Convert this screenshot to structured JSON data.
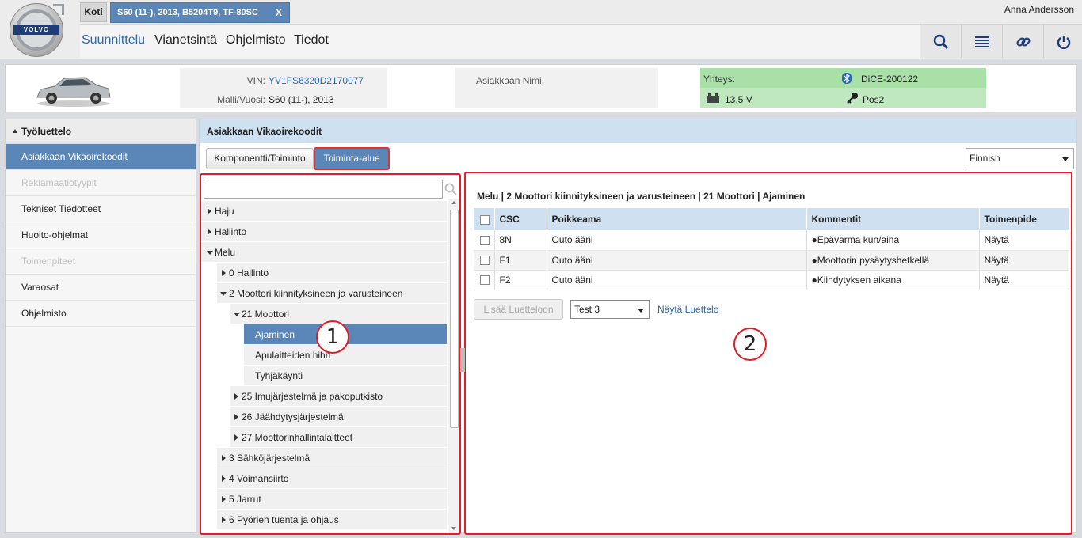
{
  "header": {
    "logo_text": "VOLVO",
    "tab_home": "Koti",
    "tab_vehicle": "S60 (11-), 2013, B5204T9, TF-80SC",
    "tab_close": "X",
    "user": "Anna Andersson",
    "nav": [
      "Suunnittelu",
      "Vianetsintä",
      "Ohjelmisto",
      "Tiedot"
    ],
    "tools": [
      "search-icon",
      "list-icon",
      "link-icon",
      "power-icon"
    ]
  },
  "vehicle": {
    "vin_label": "VIN:",
    "vin": "YV1FS6320D2170077",
    "model_label": "Malli/Vuosi:",
    "model": "S60 (11-), 2013",
    "customer_label": "Asiakkaan Nimi:",
    "conn_label": "Yhteys:",
    "device": "DiCE-200122",
    "voltage": "13,5 V",
    "key_pos": "Pos2"
  },
  "sidebar": {
    "title": "Työluettelo",
    "items": [
      {
        "label": "Asiakkaan Vikaoirekoodit",
        "state": "active"
      },
      {
        "label": "Reklamaatiotyypit",
        "state": "disabled"
      },
      {
        "label": "Tekniset Tiedotteet",
        "state": "normal"
      },
      {
        "label": "Huolto-ohjelmat",
        "state": "normal"
      },
      {
        "label": "Toimenpiteet",
        "state": "disabled"
      },
      {
        "label": "Varaosat",
        "state": "normal"
      },
      {
        "label": "Ohjelmisto",
        "state": "normal"
      }
    ]
  },
  "content": {
    "title": "Asiakkaan Vikaoirekoodit",
    "btn_component": "Komponentti/Toiminto",
    "btn_area": "Toiminta-alue",
    "language": "Finnish"
  },
  "tree": [
    "Haju",
    "Hallinto",
    "Melu",
    "0 Hallinto",
    "2 Moottori kiinnityksineen ja varusteineen",
    "21 Moottori",
    "Ajaminen",
    "Apulaitteiden hihn",
    "Tyhjäkäynti",
    "25 Imujärjestelmä ja pakoputkisto",
    "26 Jäähdytysjärjestelmä",
    "27 Moottorinhallintalaitteet",
    "3 Sähköjärjestelmä",
    "4 Voimansiirto",
    "5 Jarrut",
    "6 Pyörien tuenta ja ohjaus"
  ],
  "detail": {
    "breadcrumb": "Melu | 2 Moottori kiinnityksineen ja varusteineen | 21 Moottori | Ajaminen",
    "columns": [
      "CSC",
      "Poikkeama",
      "Kommentit",
      "Toimenpide"
    ],
    "rows": [
      {
        "csc": "8N",
        "dev": "Outo ääni",
        "comment": "Epävarma kun/aina",
        "action": "Näytä"
      },
      {
        "csc": "F1",
        "dev": "Outo ääni",
        "comment": "Moottorin pysäytyshetkellä",
        "action": "Näytä"
      },
      {
        "csc": "F2",
        "dev": "Outo ääni",
        "comment": "Kiihdytyksen aikana",
        "action": "Näytä"
      }
    ],
    "btn_add": "Lisää Luetteloon",
    "list_value": "Test 3",
    "show_list": "Näytä Luettelo"
  },
  "callouts": [
    "1",
    "2"
  ]
}
